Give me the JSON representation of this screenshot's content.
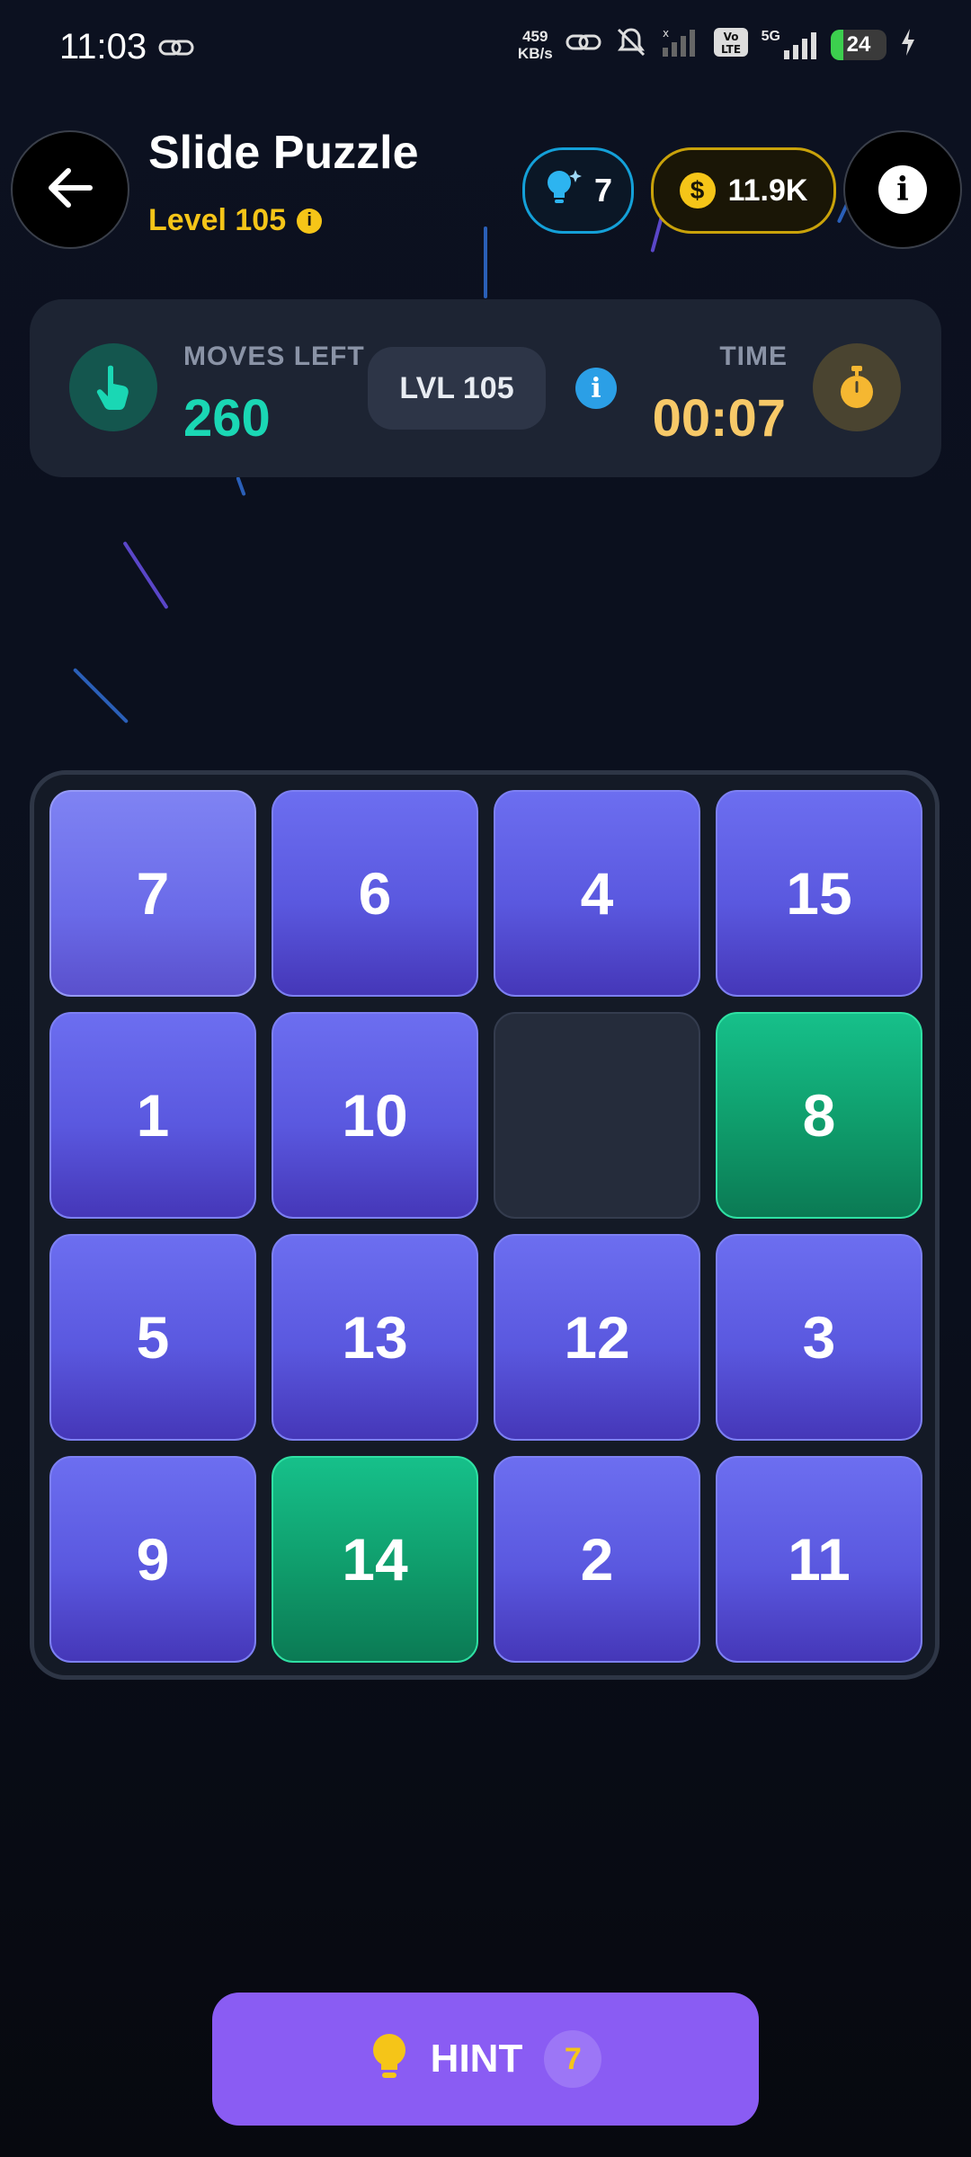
{
  "status_bar": {
    "time": "11:03",
    "net_speed_value": "459",
    "net_speed_unit": "KB/s",
    "network": "5G",
    "battery": "24"
  },
  "header": {
    "title": "Slide Puzzle",
    "level_text": "Level 105",
    "hints_count": "7",
    "coins": "11.9K"
  },
  "stats": {
    "moves_label": "MOVES LEFT",
    "moves_value": "260",
    "level_badge": "LVL 105",
    "time_label": "TIME",
    "time_value": "00:07"
  },
  "board": {
    "tiles": [
      {
        "value": "7",
        "state": "light"
      },
      {
        "value": "6",
        "state": "blue"
      },
      {
        "value": "4",
        "state": "blue"
      },
      {
        "value": "15",
        "state": "blue"
      },
      {
        "value": "1",
        "state": "blue"
      },
      {
        "value": "10",
        "state": "blue"
      },
      {
        "value": "",
        "state": "empty"
      },
      {
        "value": "8",
        "state": "green"
      },
      {
        "value": "5",
        "state": "blue"
      },
      {
        "value": "13",
        "state": "blue"
      },
      {
        "value": "12",
        "state": "blue"
      },
      {
        "value": "3",
        "state": "blue"
      },
      {
        "value": "9",
        "state": "blue"
      },
      {
        "value": "14",
        "state": "green"
      },
      {
        "value": "2",
        "state": "blue"
      },
      {
        "value": "11",
        "state": "blue"
      }
    ]
  },
  "hint_button": {
    "label": "HINT",
    "count": "7"
  },
  "colors": {
    "accent_purple": "#8a5cf3",
    "tile_blue": "#5a58df",
    "tile_green": "#0f9c6b",
    "moves_teal": "#1ad7b4",
    "time_gold": "#f7c968",
    "coin_gold": "#f5c518"
  }
}
